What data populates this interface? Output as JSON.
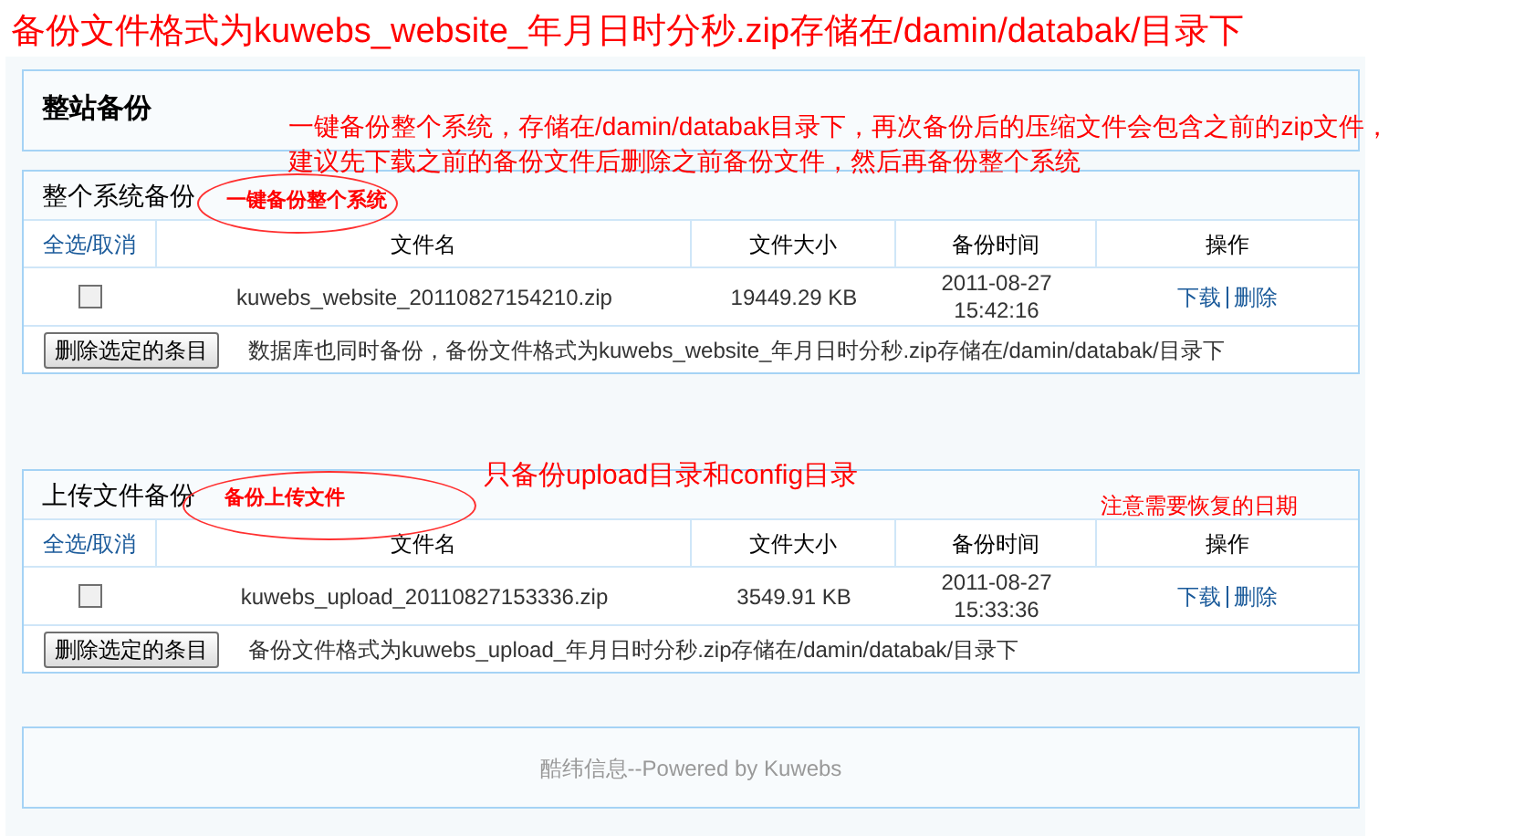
{
  "title": "备份文件格式为kuwebs_website_年月日时分秒.zip存储在/damin/databak/目录下",
  "page_heading": "整站备份",
  "sections": [
    {
      "header": "整个系统备份",
      "select_all": "全选/取消",
      "columns": [
        "文件名",
        "文件大小",
        "备份时间",
        "操作"
      ],
      "rows": [
        {
          "checked": false,
          "file": "kuwebs_website_20110827154210.zip",
          "size": "19449.29 KB",
          "date": "2011-08-27",
          "time": "15:42:16",
          "download": "下载",
          "delete": "删除"
        }
      ],
      "delete_button": "删除选定的条目",
      "note": "数据库也同时备份，备份文件格式为kuwebs_website_年月日时分秒.zip存储在/damin/databak/目录下",
      "annotations": [
        {
          "kind": "circled",
          "text": "一键备份整个系统"
        },
        {
          "kind": "note",
          "text": "一键备份整个系统，存储在/damin/databak目录下，再次备份后的压缩文件会包含之前的zip文件，"
        },
        {
          "kind": "note2",
          "text": "建议先下载之前的备份文件后删除之前备份文件，然后再备份整个系统"
        }
      ]
    },
    {
      "header": "上传文件备份",
      "select_all": "全选/取消",
      "columns": [
        "文件名",
        "文件大小",
        "备份时间",
        "操作"
      ],
      "rows": [
        {
          "checked": false,
          "file": "kuwebs_upload_20110827153336.zip",
          "size": "3549.91 KB",
          "date": "2011-08-27",
          "time": "15:33:36",
          "download": "下载",
          "delete": "删除"
        }
      ],
      "delete_button": "删除选定的条目",
      "note": "备份文件格式为kuwebs_upload_年月日时分秒.zip存储在/damin/databak/目录下",
      "annotations": [
        {
          "kind": "circled",
          "text": "备份上传文件"
        },
        {
          "kind": "note",
          "text": "只备份upload目录和config目录"
        },
        {
          "kind": "side",
          "text": "注意需要恢复的日期"
        }
      ]
    }
  ],
  "footer": "酷纬信息--Powered by Kuwebs"
}
